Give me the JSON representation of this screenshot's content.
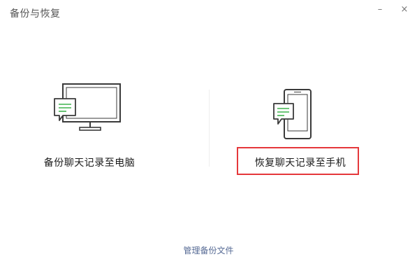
{
  "window": {
    "title": "备份与恢复",
    "minimize_label": "–",
    "close_label": "×"
  },
  "options": {
    "backup_to_pc": {
      "label": "备份聊天记录至电脑",
      "icon": "monitor-chat-icon"
    },
    "restore_to_phone": {
      "label": "恢复聊天记录至手机",
      "icon": "phone-chat-icon"
    }
  },
  "footer": {
    "manage_link": "管理备份文件"
  },
  "colors": {
    "accent_green": "#3fb34f",
    "link_blue": "#576b95",
    "highlight_red": "#e5383b",
    "outline_dark": "#3a3a3a"
  }
}
